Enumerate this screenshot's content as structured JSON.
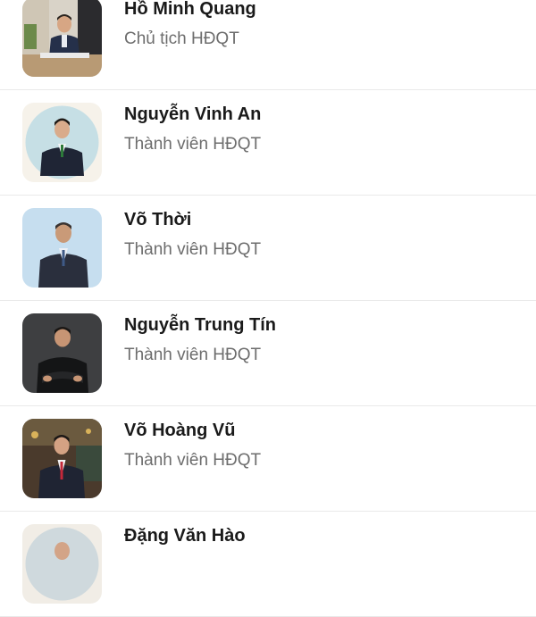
{
  "members": [
    {
      "name": "Hồ Minh Quang",
      "role": "Chủ tịch HĐQT",
      "avatar": "person-at-desk-photo"
    },
    {
      "name": "Nguyễn Vinh An",
      "role": "Thành viên HĐQT",
      "avatar": "person-portrait-circle-photo"
    },
    {
      "name": "Võ Thời",
      "role": "Thành viên HĐQT",
      "avatar": "person-portrait-photo"
    },
    {
      "name": "Nguyễn Trung Tín",
      "role": "Thành viên HĐQT",
      "avatar": "person-arms-crossed-photo"
    },
    {
      "name": "Võ Hoàng Vũ",
      "role": "Thành viên HĐQT",
      "avatar": "person-portrait-photo"
    },
    {
      "name": "Đặng Văn Hào",
      "role": "",
      "avatar": "person-portrait-photo"
    }
  ]
}
